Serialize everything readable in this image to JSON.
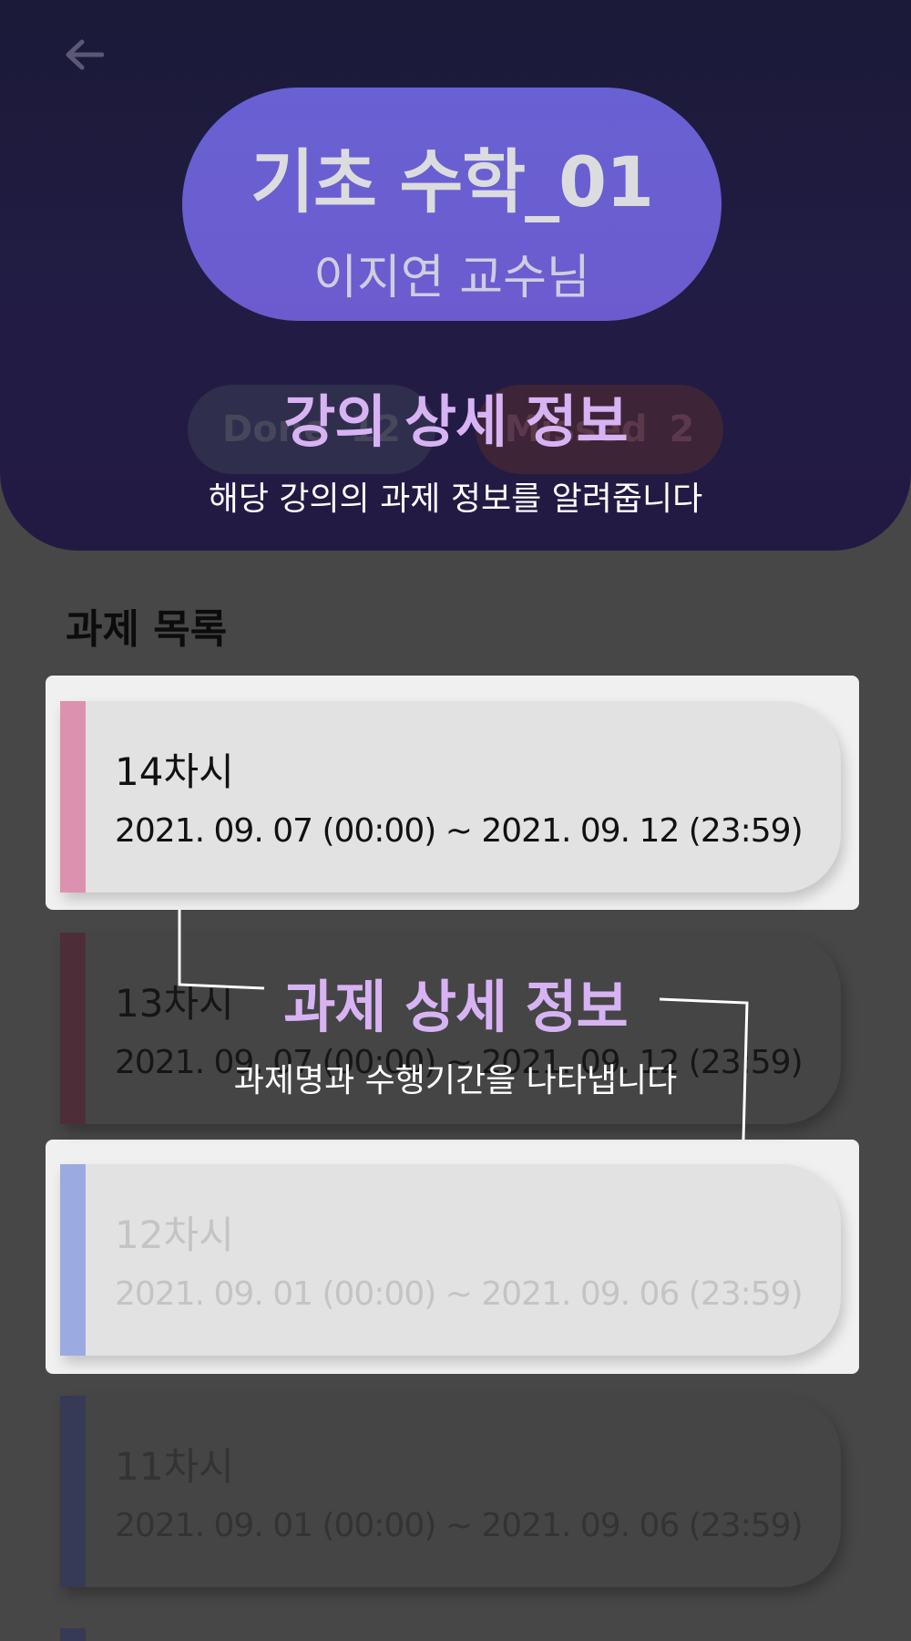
{
  "header": {
    "course_title": "기초 수학_01",
    "professor": "이지연 교수님",
    "done_label": "Done",
    "done_count": "12",
    "missed_label": "Missed",
    "missed_count": "2"
  },
  "overlays": {
    "lecture_info_title": "강의 상세 정보",
    "lecture_info_desc": "해당 강의의 과제 정보를 알려줍니다",
    "assignment_info_title": "과제 상세 정보",
    "assignment_info_desc": "과제명과 수행기간을 나타냅니다"
  },
  "section_title": "과제 목록",
  "assignments": [
    {
      "name": "14차시",
      "period": "2021. 09. 07 (00:00) ~ 2021. 09. 12 (23:59)",
      "color": "#dc92ae"
    },
    {
      "name": "13차시",
      "period": "2021. 09. 07 (00:00) ~ 2021. 09. 12 (23:59)",
      "color": "#4d2e38"
    },
    {
      "name": "12차시",
      "period": "2021. 09. 01 (00:00) ~ 2021. 09. 06 (23:59)",
      "color": "#9caae2"
    },
    {
      "name": "11차시",
      "period": "2021. 09. 01 (00:00) ~ 2021. 09. 06 (23:59)",
      "color": "#363a54"
    }
  ],
  "icons": {
    "back": "arrow-left-icon"
  }
}
